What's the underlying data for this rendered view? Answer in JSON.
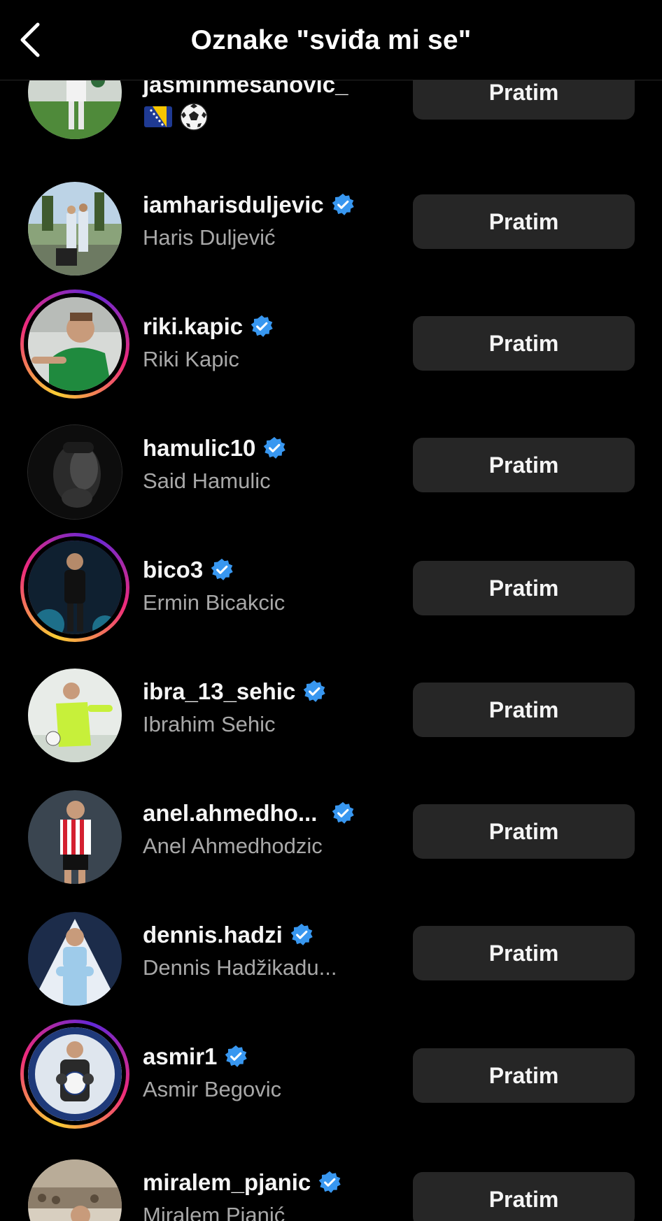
{
  "header": {
    "title": "Oznake \"sviđa mi se\""
  },
  "follow_label": "Pratim",
  "accent_colors": {
    "verified": "#3897f0",
    "button_bg": "#262626",
    "secondary_text": "#a8a8a8"
  },
  "users": [
    {
      "username": "jasminmesanovic_",
      "fullname": "",
      "verified": false,
      "emoji": [
        "bosnia-flag-icon",
        "soccer-ball-icon"
      ],
      "story_ring": false
    },
    {
      "username": "iamharisduljevic",
      "fullname": "Haris Duljević",
      "verified": true,
      "story_ring": false
    },
    {
      "username": "riki.kapic",
      "fullname": "Riki Kapic",
      "verified": true,
      "story_ring": true
    },
    {
      "username": "hamulic10",
      "fullname": "Said Hamulic",
      "verified": true,
      "story_ring": false
    },
    {
      "username": "bico3",
      "fullname": "Ermin Bicakcic",
      "verified": true,
      "story_ring": true
    },
    {
      "username": "ibra_13_sehic",
      "fullname": "Ibrahim Sehic",
      "verified": true,
      "story_ring": false
    },
    {
      "username": "anel.ahmedho...",
      "fullname": "Anel Ahmedhodzic",
      "verified": true,
      "story_ring": false
    },
    {
      "username": "dennis.hadzi",
      "fullname": "Dennis Hadžikadu...",
      "verified": true,
      "story_ring": false
    },
    {
      "username": "asmir1",
      "fullname": "Asmir Begovic",
      "verified": true,
      "story_ring": true
    },
    {
      "username": "miralem_pjanic",
      "fullname": "Miralem Pjanić",
      "verified": true,
      "story_ring": false
    }
  ]
}
